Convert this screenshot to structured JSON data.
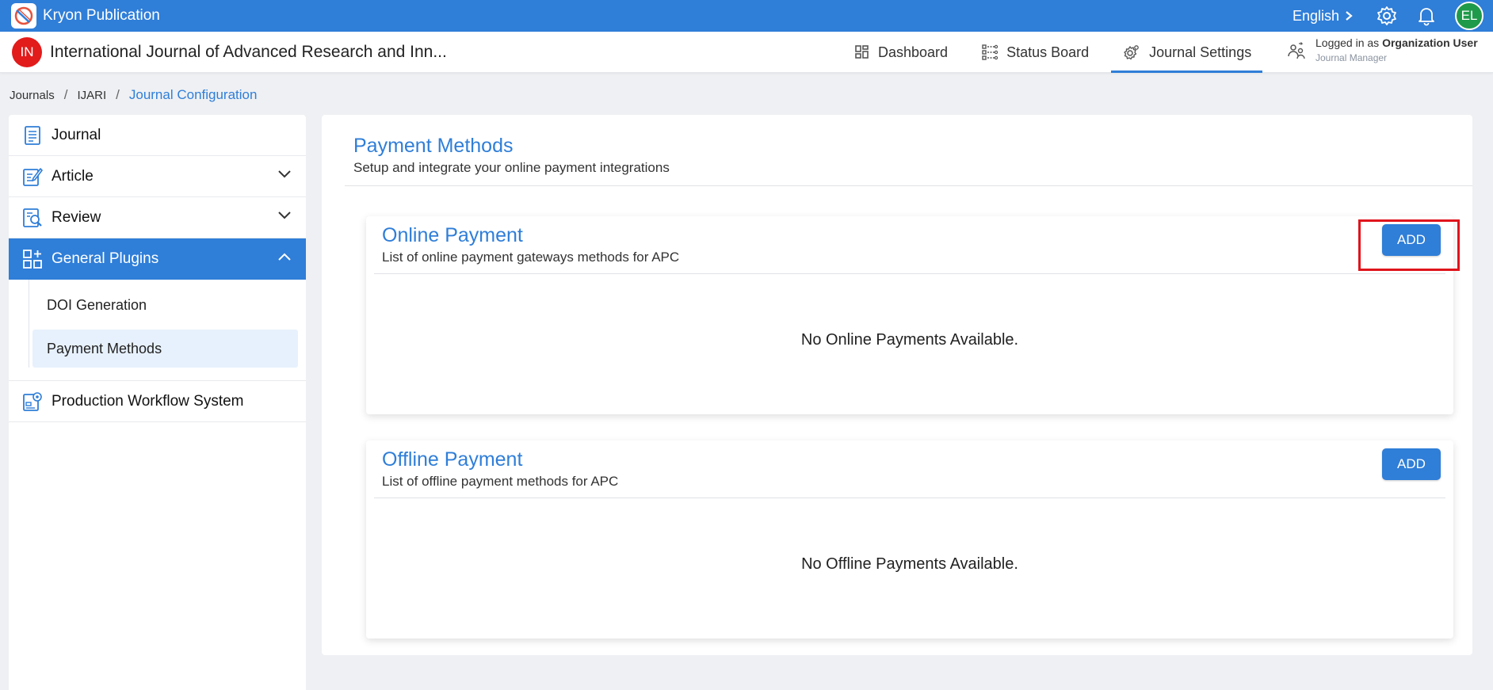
{
  "topbar": {
    "brand": "Kryon Publication",
    "language": "English",
    "avatar_initials": "EL",
    "icons": [
      "brand-logo-icon",
      "chevron-right-icon",
      "gear-icon",
      "bell-icon"
    ]
  },
  "header": {
    "journal_initials": "IN",
    "journal_title": "International Journal of Advanced Research and Inn...",
    "nav": [
      {
        "label": "Dashboard",
        "icon": "dashboard-grid-icon"
      },
      {
        "label": "Status Board",
        "icon": "status-board-icon"
      },
      {
        "label": "Journal Settings",
        "icon": "settings-gears-icon",
        "active": true
      }
    ],
    "user": {
      "prefix": "Logged in as",
      "name": "Organization User",
      "role": "Journal Manager",
      "icon": "user-switch-icon"
    }
  },
  "breadcrumb": {
    "items": [
      "Journals",
      "IJARI"
    ],
    "current": "Journal Configuration"
  },
  "sidebar": {
    "items": [
      {
        "label": "Journal",
        "icon": "journal-doc-icon"
      },
      {
        "label": "Article",
        "icon": "article-edit-icon",
        "expandable": true
      },
      {
        "label": "Review",
        "icon": "review-search-icon",
        "expandable": true
      },
      {
        "label": "General Plugins",
        "icon": "plugins-grid-icon",
        "active": true,
        "expanded": true
      },
      {
        "label": "Production Workflow System",
        "icon": "workflow-system-icon"
      }
    ],
    "sub_items": [
      {
        "label": "DOI Generation"
      },
      {
        "label": "Payment Methods",
        "selected": true
      }
    ]
  },
  "main": {
    "title": "Payment Methods",
    "subtitle": "Setup and integrate your online payment integrations",
    "online": {
      "title": "Online Payment",
      "subtitle": "List of online payment gateways methods for APC",
      "add_label": "ADD",
      "empty": "No Online Payments Available."
    },
    "offline": {
      "title": "Offline Payment",
      "subtitle": "List of offline payment methods for APC",
      "add_label": "ADD",
      "empty": "No Offline Payments Available."
    }
  },
  "colors": {
    "accent": "#2f7ed8",
    "highlight": "#e0141c",
    "journal_avatar": "#e21b1b",
    "user_avatar": "#1f9a4a"
  }
}
